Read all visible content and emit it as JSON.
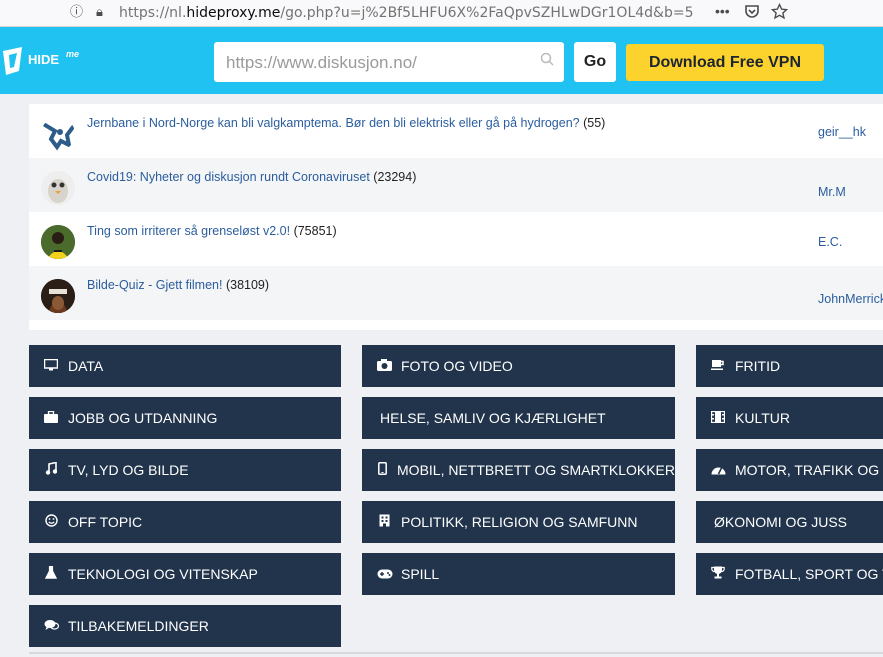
{
  "browser": {
    "url_prefix": "https://nl.",
    "url_host": "hideproxy.me",
    "url_path": "/go.php?u=j%2Bf5LHFU6X%2FaQpvSZHLwDGr1OL4d&b=5",
    "more_icon": "•••"
  },
  "proxy": {
    "logo_text": "HIDE",
    "logo_sup": "me",
    "search_placeholder": "https://www.diskusjon.no/",
    "go_label": "Go",
    "vpn_label": "Download Free VPN"
  },
  "threads": [
    {
      "title": "Jernbane i Nord-Norge kan bli valgkamptema. Bør den bli elektrisk eller gå på hydrogen?",
      "count": "(55)",
      "user": "geir__hk"
    },
    {
      "title": "Covid19: Nyheter og diskusjon rundt Coronaviruset",
      "count": "(23294)",
      "user": "Mr.M"
    },
    {
      "title": "Ting som irriterer så grenseløst v2.0!",
      "count": "(75851)",
      "user": "E.C."
    },
    {
      "title": "Bilde-Quiz - Gjett filmen!",
      "count": "(38109)",
      "user": "JohnMerrick"
    }
  ],
  "categories": [
    {
      "label": "DATA",
      "icon": "monitor-icon",
      "glyph": "▭"
    },
    {
      "label": "FOTO OG VIDEO",
      "icon": "camera-icon",
      "glyph": "◉"
    },
    {
      "label": "FRITID",
      "icon": "coffee-icon",
      "glyph": "☕"
    },
    {
      "label": "JOBB OG UTDANNING",
      "icon": "briefcase-icon",
      "glyph": "▣"
    },
    {
      "label": "HELSE, SAMLIV OG KJÆRLIGHET",
      "icon": "",
      "glyph": ""
    },
    {
      "label": "KULTUR",
      "icon": "film-icon",
      "glyph": "▦"
    },
    {
      "label": "TV, LYD OG BILDE",
      "icon": "music-icon",
      "glyph": "♫"
    },
    {
      "label": "MOBIL, NETTBRETT OG SMARTKLOKKER",
      "icon": "mobile-icon",
      "glyph": "▯"
    },
    {
      "label": "MOTOR, TRAFIKK OG MEKKING",
      "icon": "dashboard-icon",
      "glyph": "◕"
    },
    {
      "label": "OFF TOPIC",
      "icon": "smile-icon",
      "glyph": "☺"
    },
    {
      "label": "POLITIKK, RELIGION OG SAMFUNN",
      "icon": "building-icon",
      "glyph": "▥"
    },
    {
      "label": "ØKONOMI OG JUSS",
      "icon": "",
      "glyph": ""
    },
    {
      "label": "TEKNOLOGI OG VITENSKAP",
      "icon": "flask-icon",
      "glyph": "⚗"
    },
    {
      "label": "SPILL",
      "icon": "gamepad-icon",
      "glyph": "⊶"
    },
    {
      "label": "FOTBALL, SPORT OG TRENING",
      "icon": "trophy-icon",
      "glyph": "♕"
    },
    {
      "label": "TILBAKEMELDINGER",
      "icon": "comments-icon",
      "glyph": "✉"
    }
  ]
}
